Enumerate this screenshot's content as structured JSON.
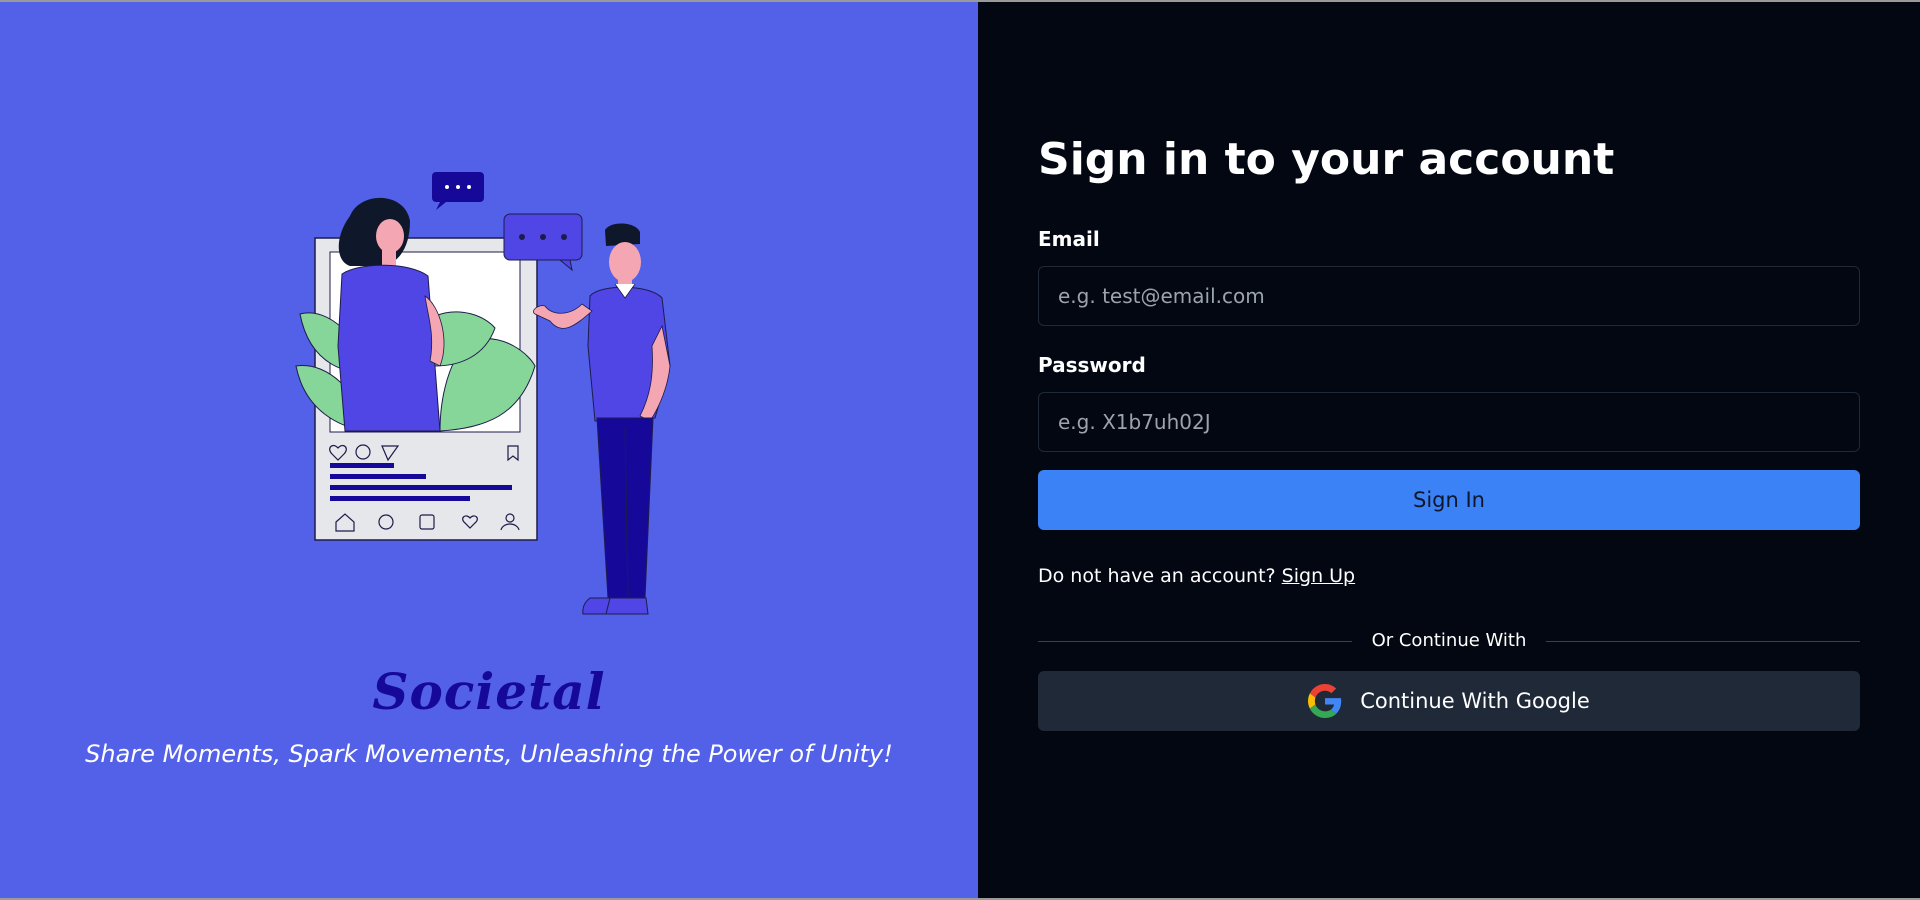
{
  "brand": {
    "name": "Societal",
    "tagline": "Share Moments, Spark Movements, Unleashing the Power of Unity!"
  },
  "form": {
    "title": "Sign in to your account",
    "email_label": "Email",
    "email_placeholder": "e.g. test@email.com",
    "email_value": "",
    "password_label": "Password",
    "password_placeholder": "e.g. X1b7uh02J",
    "password_value": "",
    "signin_label": "Sign In",
    "signup_prompt": "Do not have an account?",
    "signup_link": "Sign Up",
    "divider_text": "Or Continue With",
    "google_label": "Continue With Google"
  },
  "icons": {
    "google": "google-icon",
    "illustration": "social-media-illustration-icon"
  },
  "colors": {
    "left_panel": "#5360e8",
    "right_panel": "#030712",
    "brand_text": "#16099a",
    "primary_button": "#3b82f6",
    "google_button": "#1f2937"
  }
}
